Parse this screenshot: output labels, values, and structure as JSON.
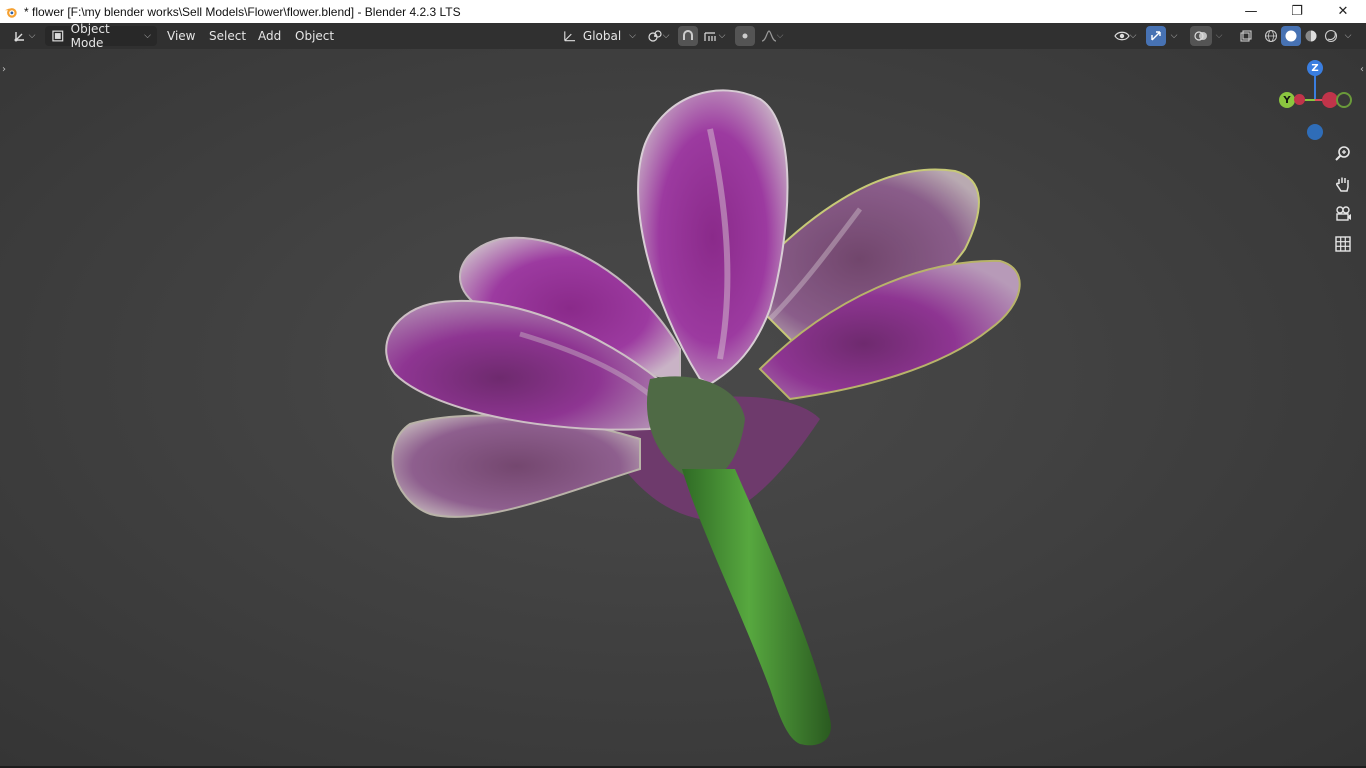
{
  "window": {
    "title": "* flower [F:\\my blender works\\Sell Models\\Flower\\flower.blend] - Blender 4.2.3 LTS",
    "minimize": "—",
    "restore": "❐",
    "close": "✕"
  },
  "header": {
    "editor_type_icon": "editor-type-icon",
    "mode": "Object Mode",
    "menus": [
      "View",
      "Select",
      "Add",
      "Object"
    ],
    "transform_orientation": "Global",
    "shading_modes": [
      "wireframe",
      "solid",
      "material-preview",
      "rendered"
    ],
    "active_shading": "solid"
  },
  "gizmo": {
    "axis_z": "Z",
    "axis_y": "Y",
    "axis_x": "X"
  },
  "colors": {
    "accent": "#4772b3",
    "axis_x": "#e0495a",
    "axis_y": "#8bc53f",
    "axis_z": "#3a7ee0",
    "header_bg": "#303030",
    "viewport_bg": "#3f3f3f"
  },
  "viewport": {
    "object": "flower"
  }
}
